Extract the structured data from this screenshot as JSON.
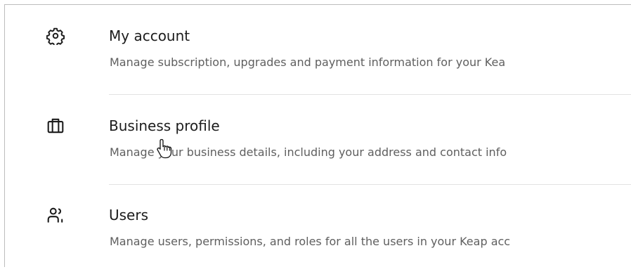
{
  "settings": {
    "items": [
      {
        "title": "My account",
        "description": "Manage subscription, upgrades and payment information for your Kea",
        "icon": "gear-icon"
      },
      {
        "title": "Business profile",
        "description": "Manage your business details, including your address and contact info",
        "icon": "briefcase-icon"
      },
      {
        "title": "Users",
        "description": "Manage users, permissions, and roles for all the users in your Keap acc",
        "icon": "users-icon"
      }
    ]
  },
  "colors": {
    "title": "#1c1c1c",
    "description": "#5f5f5f",
    "divider": "#e3e3e3"
  }
}
